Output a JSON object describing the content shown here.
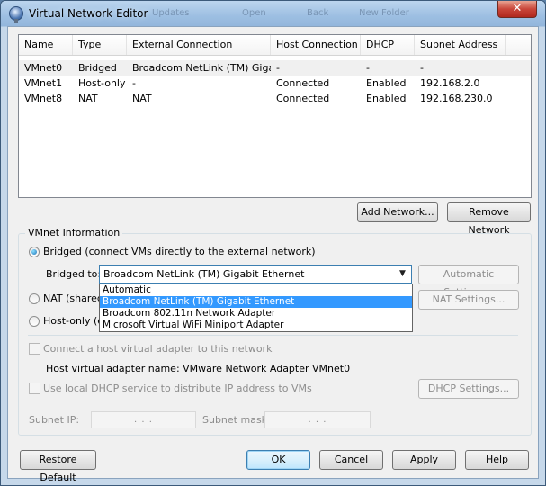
{
  "window": {
    "title": "Virtual Network Editor",
    "close_glyph": "✕",
    "background_ghost_items": [
      "Updates",
      "Open",
      "Back",
      "New Folder"
    ]
  },
  "table": {
    "columns": [
      "Name",
      "Type",
      "External Connection",
      "Host Connection",
      "DHCP",
      "Subnet Address"
    ],
    "rows": [
      {
        "name": "VMnet0",
        "type": "Bridged",
        "external": "Broadcom NetLink (TM) Giga...",
        "host": "-",
        "dhcp": "-",
        "subnet": "-",
        "selected": true
      },
      {
        "name": "VMnet1",
        "type": "Host-only",
        "external": "-",
        "host": "Connected",
        "dhcp": "Enabled",
        "subnet": "192.168.2.0",
        "selected": false
      },
      {
        "name": "VMnet8",
        "type": "NAT",
        "external": "NAT",
        "host": "Connected",
        "dhcp": "Enabled",
        "subnet": "192.168.230.0",
        "selected": false
      }
    ]
  },
  "buttons": {
    "add_network": "Add Network...",
    "remove_network": "Remove Network",
    "automatic_settings": "Automatic Settings...",
    "nat_settings": "NAT Settings...",
    "dhcp_settings": "DHCP Settings...",
    "restore_default": "Restore Default",
    "ok": "OK",
    "cancel": "Cancel",
    "apply": "Apply",
    "help": "Help"
  },
  "vmnet_info": {
    "group_title": "VMnet Information",
    "bridged_label": "Bridged (connect VMs directly to the external network)",
    "bridged_to_label": "Bridged to:",
    "bridged_to_value": "Broadcom NetLink (TM) Gigabit Ethernet",
    "nat_label": "NAT (shared",
    "hostonly_label": "Host-only (co",
    "connect_adapter_label": "Connect a host virtual adapter to this network",
    "adapter_name_label": "Host virtual adapter name: VMware Network Adapter VMnet0",
    "dhcp_label": "Use local DHCP service to distribute IP address to VMs",
    "subnet_ip_label": "Subnet IP:",
    "subnet_mask_label": "Subnet mask:",
    "ip_placeholder": ".     .     .",
    "selected_mode": "bridged"
  },
  "dropdown": {
    "options": [
      "Automatic",
      "Broadcom NetLink (TM) Gigabit Ethernet",
      "Broadcom 802.11n Network Adapter",
      "Microsoft Virtual WiFi Miniport Adapter"
    ],
    "highlighted_index": 1
  },
  "colors": {
    "highlight": "#3399ff",
    "title_bar": "#9dbfe2",
    "close_button": "#c9463a"
  }
}
